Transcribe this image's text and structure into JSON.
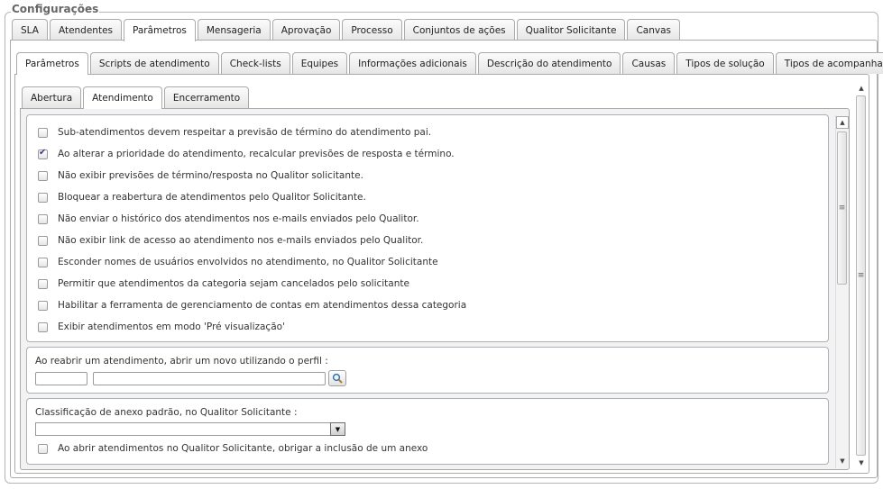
{
  "fieldset": {
    "legend": "Configurações"
  },
  "tabs_main": [
    "SLA",
    "Atendentes",
    "Parâmetros",
    "Mensageria",
    "Aprovação",
    "Processo",
    "Conjuntos de ações",
    "Qualitor Solicitante",
    "Canvas"
  ],
  "tabs_main_active": "Parâmetros",
  "tabs_sub": [
    "Parâmetros",
    "Scripts de atendimento",
    "Check-lists",
    "Equipes",
    "Informações adicionais",
    "Descrição do atendimento",
    "Causas",
    "Tipos de solução",
    "Tipos de acompanhamento"
  ],
  "tabs_sub_active": "Parâmetros",
  "tabs_phase": [
    "Abertura",
    "Atendimento",
    "Encerramento"
  ],
  "tabs_phase_active": "Atendimento",
  "checkboxes": [
    {
      "label": "Sub-atendimentos devem respeitar a previsão de término do atendimento pai.",
      "checked": false
    },
    {
      "label": "Ao alterar a prioridade do atendimento, recalcular previsões de resposta e término.",
      "checked": true
    },
    {
      "label": "Não exibir previsões de término/resposta no Qualitor solicitante.",
      "checked": false
    },
    {
      "label": "Bloquear a reabertura de atendimentos pelo Qualitor Solicitante.",
      "checked": false
    },
    {
      "label": "Não enviar o histórico dos atendimentos nos e-mails enviados pelo Qualitor.",
      "checked": false
    },
    {
      "label": "Não exibir link de acesso ao atendimento nos e-mails enviados pelo Qualitor.",
      "checked": false
    },
    {
      "label": "Esconder nomes de usuários envolvidos no atendimento, no Qualitor Solicitante",
      "checked": false
    },
    {
      "label": "Permitir que atendimentos da categoria sejam cancelados pelo solicitante",
      "checked": false
    },
    {
      "label": "Habilitar a ferramenta de gerenciamento de contas em atendimentos dessa categoria",
      "checked": false
    },
    {
      "label": "Exibir atendimentos em modo 'Pré visualização'",
      "checked": false
    }
  ],
  "reopen": {
    "label": "Ao reabrir um atendimento, abrir um novo utilizando o perfil :",
    "code_value": "",
    "name_value": "",
    "lookup_icon": "search-icon"
  },
  "anexo": {
    "label": "Classificação de anexo padrão, no Qualitor Solicitante :",
    "select_value": "",
    "checkbox_label": "Ao abrir atendimentos no Qualitor Solicitante, obrigar a inclusão de um anexo",
    "checkbox_checked": false
  },
  "colors": {
    "border": "#aaaaaa",
    "panel_bg": "#f2f2f2",
    "group_border": "#aab0b8"
  }
}
